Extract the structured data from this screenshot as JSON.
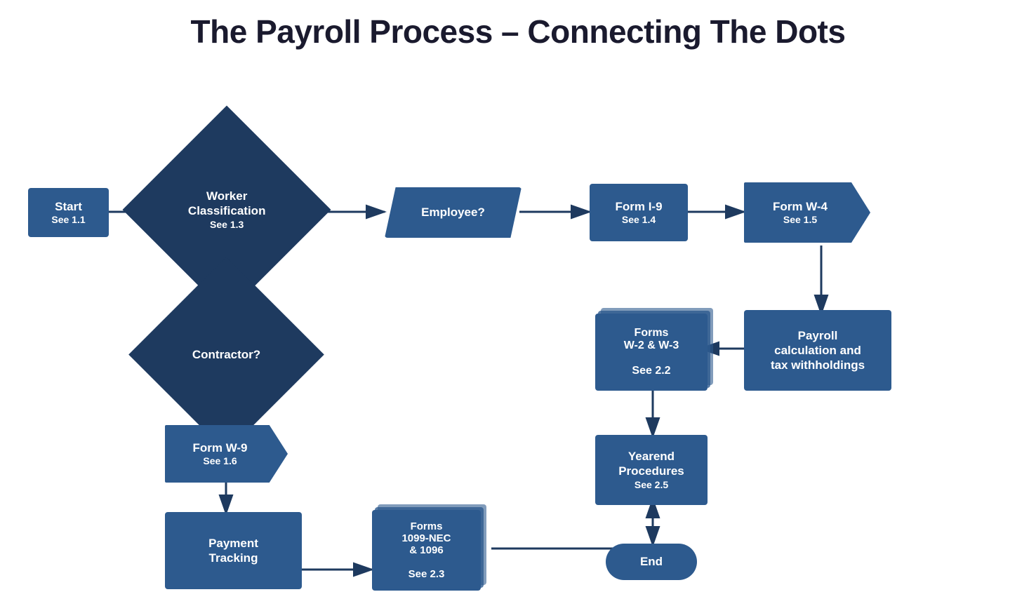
{
  "title": "The Payroll Process – Connecting The Dots",
  "nodes": {
    "start": {
      "label": "Start",
      "sub": "See 1.1"
    },
    "worker_classification": {
      "label": "Worker\nClassification",
      "sub": "See 1.3"
    },
    "employee": {
      "label": "Employee?"
    },
    "form_i9": {
      "label": "Form I-9",
      "sub": "See 1.4"
    },
    "form_w4": {
      "label": "Form W-4",
      "sub": "See 1.5"
    },
    "contractor": {
      "label": "Contractor?"
    },
    "forms_w2w3": {
      "label": "Forms\nW-2 & W-3",
      "sub": "See 2.2"
    },
    "payroll_calc": {
      "label": "Payroll\ncalculation and\ntax withholdings"
    },
    "yearend": {
      "label": "Yearend\nProcedures",
      "sub": "See 2.5"
    },
    "end": {
      "label": "End"
    },
    "form_w9": {
      "label": "Form W-9",
      "sub": "See 1.6"
    },
    "payment_tracking": {
      "label": "Payment\nTracking"
    },
    "forms_1099": {
      "label": "Forms\n1099-NEC\n& 1096",
      "sub": "See 2.3"
    }
  },
  "colors": {
    "dark_navy": "#1e3a5f",
    "medium_blue": "#2d5a8e",
    "white": "#ffffff"
  }
}
